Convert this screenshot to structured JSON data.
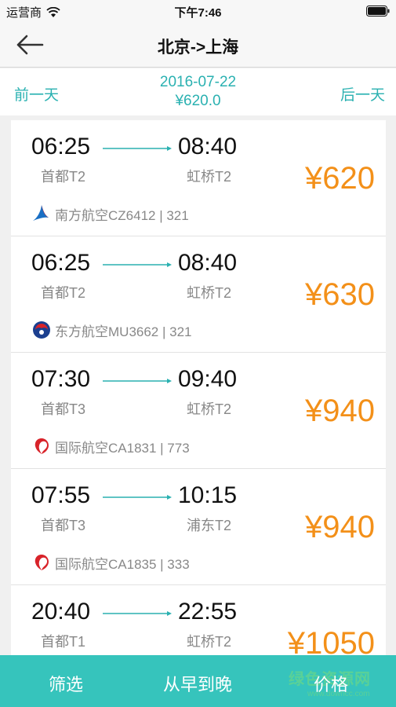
{
  "status": {
    "carrier": "运营商",
    "time": "下午7:46"
  },
  "nav": {
    "title": "北京->上海"
  },
  "date_bar": {
    "prev": "前一天",
    "date": "2016-07-22",
    "lowest": "¥620.0",
    "next": "后一天"
  },
  "flights": [
    {
      "dep_time": "06:25",
      "arr_time": "08:40",
      "dep_airport": "首都T2",
      "arr_airport": "虹桥T2",
      "price": "¥620",
      "airline": "南方航空CZ6412 | 321",
      "logo": "china-southern-logo"
    },
    {
      "dep_time": "06:25",
      "arr_time": "08:40",
      "dep_airport": "首都T2",
      "arr_airport": "虹桥T2",
      "price": "¥630",
      "airline": "东方航空MU3662 | 321",
      "logo": "china-eastern-logo"
    },
    {
      "dep_time": "07:30",
      "arr_time": "09:40",
      "dep_airport": "首都T3",
      "arr_airport": "虹桥T2",
      "price": "¥940",
      "airline": "国际航空CA1831 | 773",
      "logo": "air-china-logo"
    },
    {
      "dep_time": "07:55",
      "arr_time": "10:15",
      "dep_airport": "首都T3",
      "arr_airport": "浦东T2",
      "price": "¥940",
      "airline": "国际航空CA1835 | 333",
      "logo": "air-china-logo"
    },
    {
      "dep_time": "20:40",
      "arr_time": "22:55",
      "dep_airport": "首都T1",
      "arr_airport": "虹桥T2",
      "price": "¥1050",
      "airline": "",
      "logo": ""
    }
  ],
  "bottom": {
    "filter": "筛选",
    "sort_time": "从早到晚",
    "price": "价格",
    "watermark": "绿色资源网",
    "watermark_sub": "www.downcc.com"
  },
  "colors": {
    "accent": "#2ab1b1",
    "price": "#f39019",
    "bottom_bar": "#36c4bc"
  }
}
